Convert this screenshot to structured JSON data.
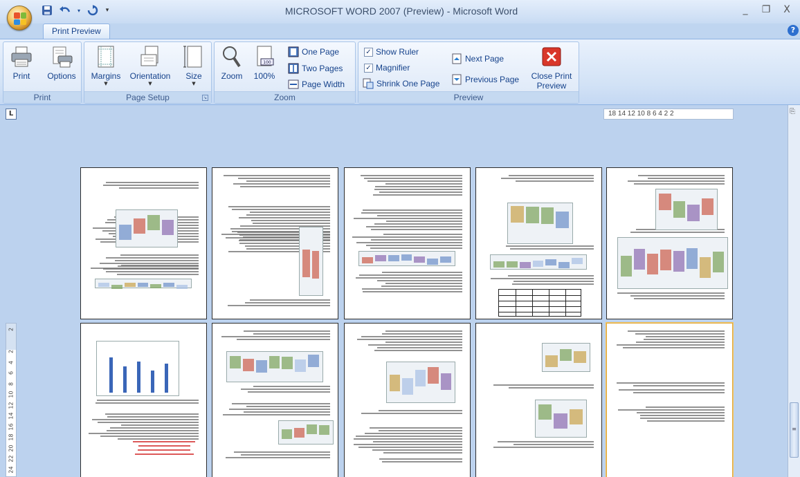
{
  "window": {
    "title": "MICROSOFT WORD 2007 (Preview) - Microsoft Word",
    "minimize": "_",
    "restore": "❐",
    "close": "X"
  },
  "quick_access": {
    "save_icon": "save-icon",
    "undo_icon": "undo-icon",
    "redo_icon": "redo-icon",
    "customize_icon": "customize-qat-icon"
  },
  "tabs": {
    "active": "Print Preview",
    "help": "?"
  },
  "ribbon": {
    "print_group": {
      "label": "Print",
      "print": "Print",
      "options": "Options"
    },
    "page_setup_group": {
      "label": "Page Setup",
      "margins": "Margins",
      "orientation": "Orientation",
      "size": "Size"
    },
    "zoom_group": {
      "label": "Zoom",
      "zoom": "Zoom",
      "percent": "100%",
      "one_page": "One Page",
      "two_pages": "Two Pages",
      "page_width": "Page Width"
    },
    "preview_group": {
      "label": "Preview",
      "show_ruler": "Show Ruler",
      "show_ruler_checked": true,
      "magnifier": "Magnifier",
      "magnifier_checked": true,
      "shrink_one_page": "Shrink One Page",
      "next_page": "Next Page",
      "previous_page": "Previous Page",
      "close_line1": "Close Print",
      "close_line2": "Preview"
    }
  },
  "ruler": {
    "toggle": "L",
    "horizontal_text": "18    14 12 10  8  6  4  2    2",
    "vertical_ticks": [
      "2",
      "2",
      "4",
      "6",
      "8",
      "10",
      "12",
      "14",
      "16",
      "18",
      "20",
      "22",
      "24"
    ]
  },
  "colors": {
    "background": "#bcd2ee",
    "accent": "#15428b",
    "selected_page": "#e0a63a",
    "close_red": "#d9372a"
  },
  "pages": {
    "rows": 2,
    "columns": 5,
    "selected_index": 9
  }
}
